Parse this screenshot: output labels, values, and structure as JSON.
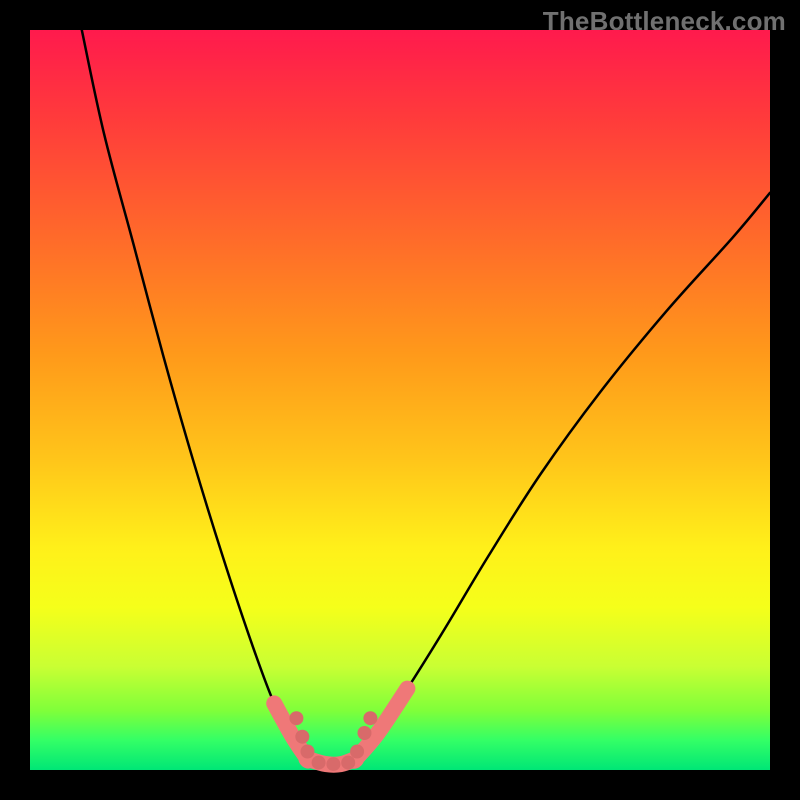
{
  "watermark": "TheBottleneck.com",
  "colors": {
    "curve": "#000000",
    "plateau": "#ef7878",
    "dot": "#d86a6a"
  },
  "chart_data": {
    "type": "line",
    "title": "",
    "xlabel": "",
    "ylabel": "",
    "xlim": [
      0,
      100
    ],
    "ylim": [
      0,
      100
    ],
    "grid": false,
    "legend": false,
    "series": [
      {
        "name": "left_branch",
        "x": [
          7,
          10,
          14,
          18,
          22,
          26,
          30,
          33,
          35.5,
          37.5
        ],
        "y": [
          100,
          86,
          71,
          56,
          42,
          29,
          17,
          9,
          4.5,
          1.5
        ]
      },
      {
        "name": "plateau",
        "x": [
          37.5,
          40,
          42,
          44
        ],
        "y": [
          1.5,
          0.8,
          0.8,
          1.5
        ]
      },
      {
        "name": "right_branch",
        "x": [
          44,
          47,
          51,
          56,
          62,
          69,
          77,
          86,
          95,
          100
        ],
        "y": [
          1.5,
          5,
          11,
          19,
          29,
          40,
          51,
          62,
          72,
          78
        ]
      }
    ],
    "highlight_points": [
      {
        "x": 36.0,
        "y": 7.0
      },
      {
        "x": 36.8,
        "y": 4.5
      },
      {
        "x": 37.5,
        "y": 2.5
      },
      {
        "x": 39.0,
        "y": 1.0
      },
      {
        "x": 41.0,
        "y": 0.8
      },
      {
        "x": 43.0,
        "y": 1.0
      },
      {
        "x": 44.2,
        "y": 2.5
      },
      {
        "x": 45.2,
        "y": 5.0
      },
      {
        "x": 46.0,
        "y": 7.0
      }
    ],
    "gradient_stops": [
      {
        "pos": 0,
        "color": "#ff1a4d"
      },
      {
        "pos": 28,
        "color": "#ff6a2a"
      },
      {
        "pos": 58,
        "color": "#ffc51a"
      },
      {
        "pos": 78,
        "color": "#f5ff1a"
      },
      {
        "pos": 100,
        "color": "#00e676"
      }
    ]
  }
}
